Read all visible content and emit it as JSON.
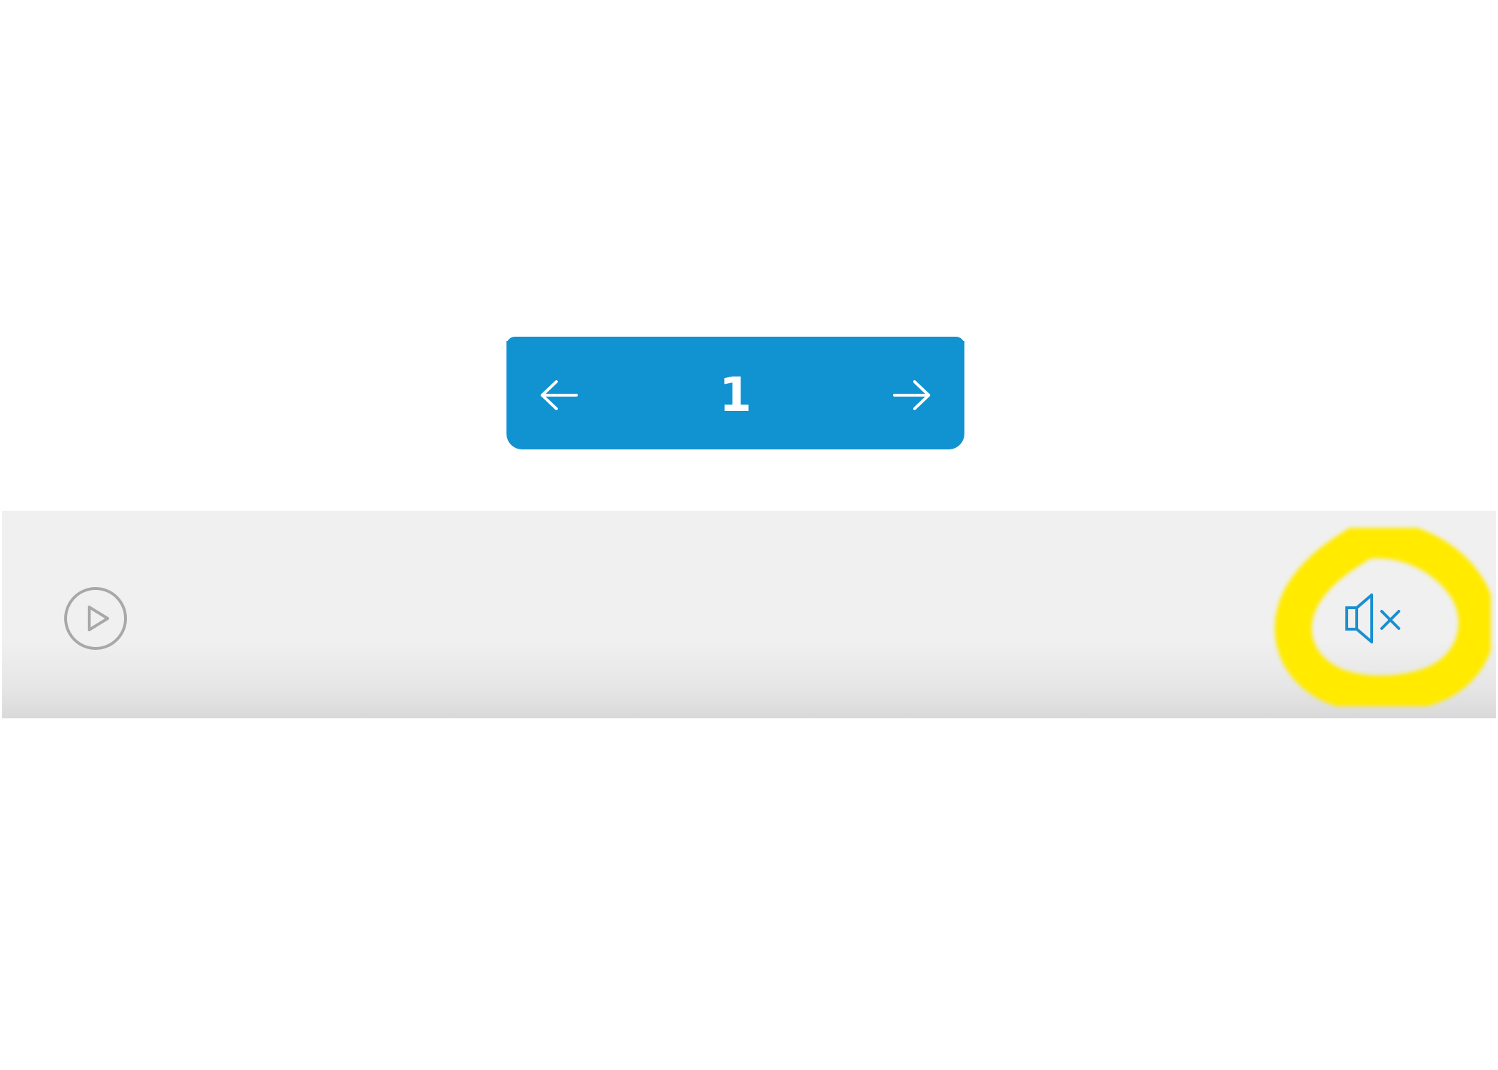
{
  "pager": {
    "prev_icon": "arrow-left-icon",
    "current_page": "1",
    "next_icon": "arrow-right-icon"
  },
  "control_bar": {
    "play_icon": "play-circle-icon",
    "mute_icon": "speaker-muted-icon"
  },
  "annotation": {
    "type": "hand-drawn-circle",
    "target": "mute-button",
    "color": "#ffea00"
  },
  "colors": {
    "accent": "#1192d1",
    "bar_background": "#f0f0f0",
    "play_icon": "#a8a8a8"
  }
}
